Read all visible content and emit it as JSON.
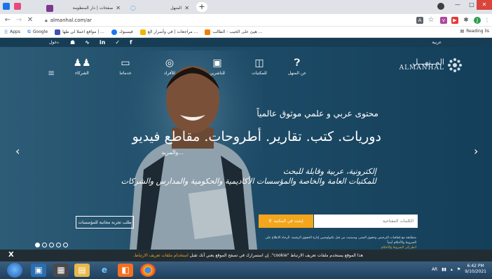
{
  "browser": {
    "tabs": [
      {
        "title": "صفحات | دار المنظومة",
        "active": false
      },
      {
        "title": "المنهل",
        "active": true
      }
    ],
    "new_tab": "+",
    "address": "almanhal.com/ar",
    "window_controls": {
      "minimize": "—",
      "maximize": "□",
      "close": "✕"
    }
  },
  "bookmarks": {
    "items": [
      {
        "label": "Apps",
        "icon": "apps-grid-icon"
      },
      {
        "label": "Google",
        "icon": "google-icon"
      },
      {
        "label": "مواقع اعملا لي طها | ...",
        "icon": "bookmark-icon"
      },
      {
        "label": "فيسبوك",
        "icon": "facebook-icon"
      },
      {
        "label": "مراجعات | في وأسرار الع ...",
        "icon": "bookmark-icon"
      },
      {
        "label": "هيئ على الحيب - الطالب ...",
        "icon": "bookmark-icon"
      }
    ],
    "reading_list": "Reading lis"
  },
  "site": {
    "topbar": {
      "login": "دخول",
      "language": "عربية"
    },
    "nav": [
      {
        "label": "الشركاء",
        "icon": "partners-icon"
      },
      {
        "label": "خدماتنا",
        "icon": "monitor-icon"
      },
      {
        "label": "للأفراد",
        "icon": "person-icon"
      },
      {
        "label": "للناشرين",
        "icon": "publisher-icon"
      },
      {
        "label": "للمكتبات",
        "icon": "book-icon"
      },
      {
        "label": "عن المنهل",
        "icon": "question-icon"
      }
    ],
    "logo": {
      "arabic": "المــنهـــل",
      "latin": "ALMANHAL"
    },
    "hero": {
      "subtitle": "محتوى عربي و علمي موثوق عالمياً",
      "title": "دوريات. كتب. تقارير. أطروحات. مقاطع فيديو",
      "more": "...والمزيد",
      "description_line1": "إلكترونية، عربية وقابلة للبحث",
      "description_line2": "للمكتبات العامة والخاصة والمؤسسات الأكاديمية والحكومية والمدارس والشركات"
    },
    "search": {
      "placeholder": "الكلمات المفتاحية",
      "button": "إبحث في المكتبة",
      "request_button": "طلب تجربة مجانية للمؤسسات"
    },
    "disclaimer": "متطابقة مع إتفاقيات الترخيص وحقوق النشر، وصممت من قبل تكنولوجيين إدارة الحقوق الرقمية. الرجاء الاطلاع على الشروط والأحكام أيضاً",
    "disclaimer_link": "أنظر إلى الشروط والأحكام",
    "carousel": {
      "total": 5,
      "active": 1
    }
  },
  "cookie": {
    "close": "X",
    "message": "هذا الموقع يستخدم ملفات تعريف الارتباط \"cookie\". إن استمرارك في تصفح الموقع يعني أنك تقبل",
    "link": "استخدام ملفات تعريف الارتباط."
  },
  "taskbar": {
    "tray": {
      "keyboard": "AR",
      "time": "6:42 PM",
      "date": "9/10/2021"
    }
  },
  "colors": {
    "accent": "#f3a51c",
    "site_bg": "#1f4d69",
    "cookie_bg": "#222d33"
  }
}
